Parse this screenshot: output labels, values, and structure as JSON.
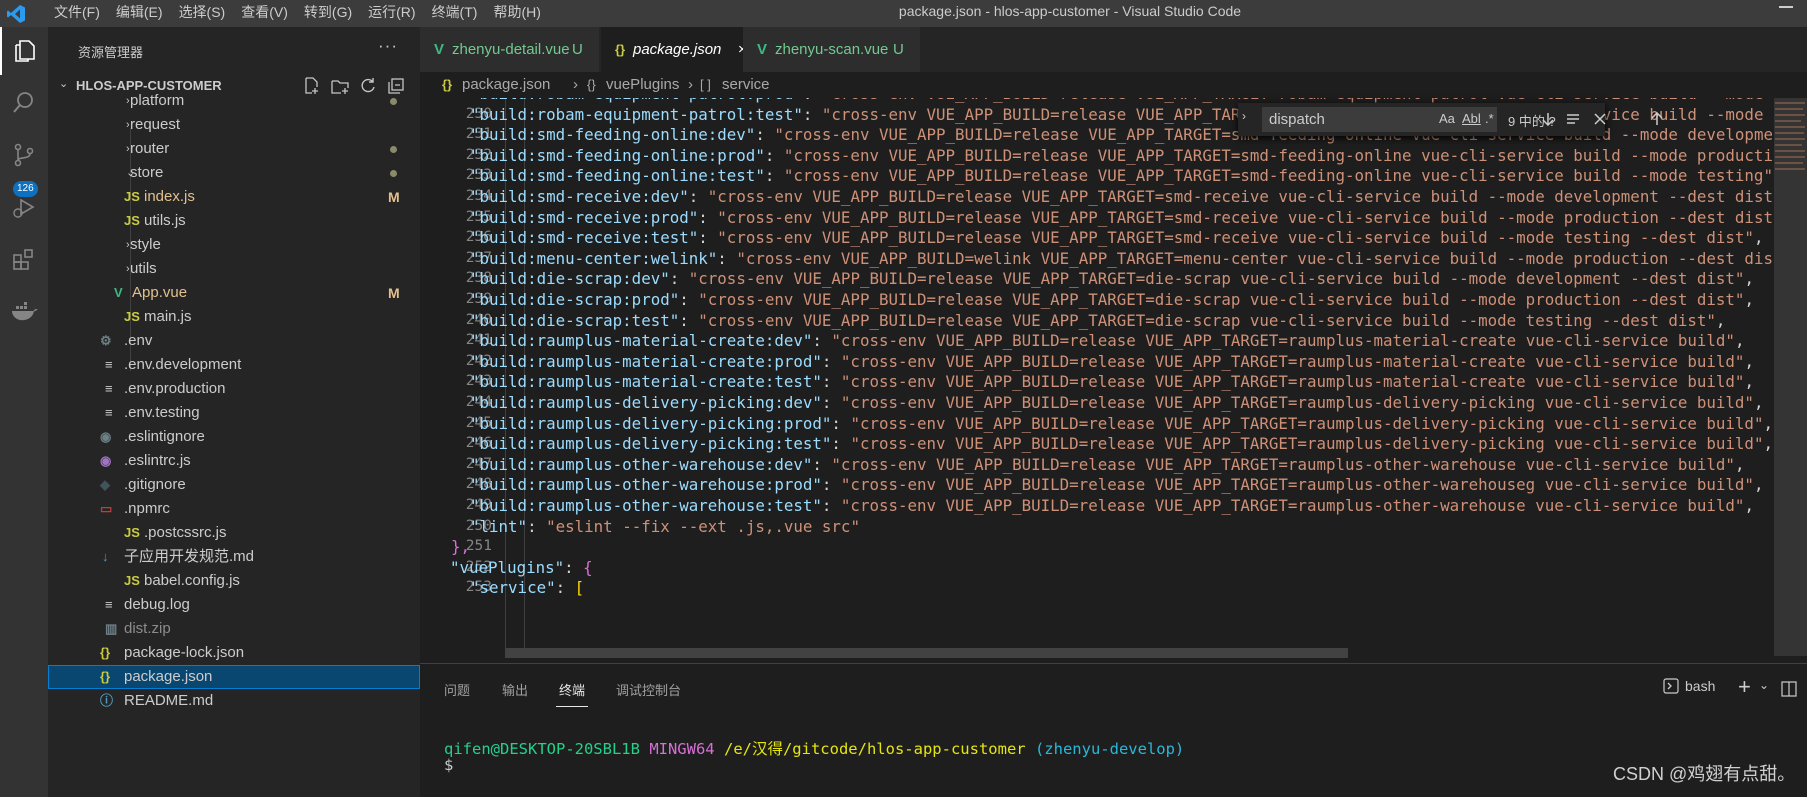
{
  "window": {
    "title": "package.json - hlos-app-customer - Visual Studio Code"
  },
  "menu": [
    "文件(F)",
    "编辑(E)",
    "选择(S)",
    "查看(V)",
    "转到(G)",
    "运行(R)",
    "终端(T)",
    "帮助(H)"
  ],
  "activity": {
    "scm_badge": "126"
  },
  "explorer": {
    "title": "资源管理器",
    "more": "···",
    "project": "HLOS-APP-CUSTOMER",
    "items": [
      {
        "name": "platform",
        "kind": "folder",
        "status": "dot"
      },
      {
        "name": "request",
        "kind": "folder",
        "status": ""
      },
      {
        "name": "router",
        "kind": "folder",
        "status": "dot"
      },
      {
        "name": "store",
        "kind": "folder-open",
        "status": "dot"
      },
      {
        "name": "index.js",
        "kind": "js",
        "status": "M"
      },
      {
        "name": "utils.js",
        "kind": "js",
        "status": ""
      },
      {
        "name": "style",
        "kind": "folder",
        "status": ""
      },
      {
        "name": "utils",
        "kind": "folder",
        "status": ""
      },
      {
        "name": "App.vue",
        "kind": "vue",
        "status": "M"
      },
      {
        "name": "main.js",
        "kind": "js",
        "status": ""
      },
      {
        "name": ".env",
        "kind": "gear",
        "status": ""
      },
      {
        "name": ".env.development",
        "kind": "lines",
        "status": ""
      },
      {
        "name": ".env.production",
        "kind": "lines",
        "status": ""
      },
      {
        "name": ".env.testing",
        "kind": "lines",
        "status": ""
      },
      {
        "name": ".eslintignore",
        "kind": "eslint-ignore",
        "status": ""
      },
      {
        "name": ".eslintrc.js",
        "kind": "eslint",
        "status": ""
      },
      {
        "name": ".gitignore",
        "kind": "git",
        "status": ""
      },
      {
        "name": ".npmrc",
        "kind": "npm",
        "status": ""
      },
      {
        "name": ".postcssrc.js",
        "kind": "js",
        "status": ""
      },
      {
        "name": "子应用开发规范.md",
        "kind": "md",
        "status": ""
      },
      {
        "name": "babel.config.js",
        "kind": "js",
        "status": ""
      },
      {
        "name": "debug.log",
        "kind": "lines",
        "status": ""
      },
      {
        "name": "dist.zip",
        "kind": "zip",
        "status": ""
      },
      {
        "name": "package-lock.json",
        "kind": "json",
        "status": ""
      },
      {
        "name": "package.json",
        "kind": "json",
        "status": "",
        "selected": true
      },
      {
        "name": "README.md",
        "kind": "info",
        "status": ""
      }
    ]
  },
  "tabs": [
    {
      "label": "zhenyu-detail.vue",
      "icon": "vue",
      "status": "U"
    },
    {
      "label": "package.json",
      "icon": "json",
      "status": "×"
    },
    {
      "label": "zhenyu-scan.vue",
      "icon": "vue",
      "status": "U"
    }
  ],
  "breadcrumb": {
    "file_icon": "{}",
    "file": "package.json",
    "sep1": "›",
    "node1_icon": "{}",
    "node1": "vuePlugins",
    "sep2": "›",
    "node2_icon": "[ ]",
    "node2": "service"
  },
  "find": {
    "query": "dispatch",
    "opt_case": "Aa",
    "opt_word": "Abl",
    "opt_regex": ".*",
    "count": "9 中的 ?"
  },
  "editor": {
    "lines": [
      {
        "n": "229",
        "k": "\"build:robam-equipment-patrol:prod\"",
        "v": "\"cross-env VUE_APP_BUILD=release VUE_APP_TARGET=robam-equipment-patrol vue-cli-service build --mode production\""
      },
      {
        "n": "230",
        "k": "\"build:robam-equipment-patrol:test\"",
        "v": "\"cross-env VUE_APP_BUILD=release VUE_APP_TARGET=robam-equipment-patrol vue-cli-service build --mode testing --dest dist/robam-equipment-patrol-file\""
      },
      {
        "n": "231",
        "k": "\"build:smd-feeding-online:dev\"",
        "v": "\"cross-env VUE_APP_BUILD=release VUE_APP_TARGET=smd-feeding-online vue-cli-service build --mode development\""
      },
      {
        "n": "232",
        "k": "\"build:smd-feeding-online:prod\"",
        "v": "\"cross-env VUE_APP_BUILD=release VUE_APP_TARGET=smd-feeding-online vue-cli-service build --mode production\""
      },
      {
        "n": "233",
        "k": "\"build:smd-feeding-online:test\"",
        "v": "\"cross-env VUE_APP_BUILD=release VUE_APP_TARGET=smd-feeding-online vue-cli-service build --mode testing\""
      },
      {
        "n": "234",
        "k": "\"build:smd-receive:dev\"",
        "v": "\"cross-env VUE_APP_BUILD=release VUE_APP_TARGET=smd-receive vue-cli-service build --mode development --dest dist\""
      },
      {
        "n": "235",
        "k": "\"build:smd-receive:prod\"",
        "v": "\"cross-env VUE_APP_BUILD=release VUE_APP_TARGET=smd-receive vue-cli-service build --mode production --dest dist\""
      },
      {
        "n": "236",
        "k": "\"build:smd-receive:test\"",
        "v": "\"cross-env VUE_APP_BUILD=release VUE_APP_TARGET=smd-receive vue-cli-service build --mode testing --dest dist\""
      },
      {
        "n": "237",
        "k": "\"build:menu-center:welink\"",
        "v": "\"cross-env VUE_APP_BUILD=welink VUE_APP_TARGET=menu-center vue-cli-service build --mode production --dest dist\""
      },
      {
        "n": "238",
        "k": "\"build:die-scrap:dev\"",
        "v": "\"cross-env VUE_APP_BUILD=release VUE_APP_TARGET=die-scrap vue-cli-service build --mode development --dest dist\""
      },
      {
        "n": "239",
        "k": "\"build:die-scrap:prod\"",
        "v": "\"cross-env VUE_APP_BUILD=release VUE_APP_TARGET=die-scrap vue-cli-service build --mode production --dest dist\""
      },
      {
        "n": "240",
        "k": "\"build:die-scrap:test\"",
        "v": "\"cross-env VUE_APP_BUILD=release VUE_APP_TARGET=die-scrap vue-cli-service build --mode testing --dest dist\""
      },
      {
        "n": "241",
        "k": "\"build:raumplus-material-create:dev\"",
        "v": "\"cross-env VUE_APP_BUILD=release VUE_APP_TARGET=raumplus-material-create vue-cli-service build\""
      },
      {
        "n": "242",
        "k": "\"build:raumplus-material-create:prod\"",
        "v": "\"cross-env VUE_APP_BUILD=release VUE_APP_TARGET=raumplus-material-create vue-cli-service build\""
      },
      {
        "n": "243",
        "k": "\"build:raumplus-material-create:test\"",
        "v": "\"cross-env VUE_APP_BUILD=release VUE_APP_TARGET=raumplus-material-create vue-cli-service build\""
      },
      {
        "n": "244",
        "k": "\"build:raumplus-delivery-picking:dev\"",
        "v": "\"cross-env VUE_APP_BUILD=release VUE_APP_TARGET=raumplus-delivery-picking vue-cli-service build\""
      },
      {
        "n": "245",
        "k": "\"build:raumplus-delivery-picking:prod\"",
        "v": "\"cross-env VUE_APP_BUILD=release VUE_APP_TARGET=raumplus-delivery-picking vue-cli-service build\""
      },
      {
        "n": "246",
        "k": "\"build:raumplus-delivery-picking:test\"",
        "v": "\"cross-env VUE_APP_BUILD=release VUE_APP_TARGET=raumplus-delivery-picking vue-cli-service build\""
      },
      {
        "n": "247",
        "k": "\"build:raumplus-other-warehouse:dev\"",
        "v": "\"cross-env VUE_APP_BUILD=release VUE_APP_TARGET=raumplus-other-warehouse vue-cli-service build\""
      },
      {
        "n": "248",
        "k": "\"build:raumplus-other-warehouse:prod\"",
        "v": "\"cross-env VUE_APP_BUILD=release VUE_APP_TARGET=raumplus-other-warehouseg vue-cli-service build\""
      },
      {
        "n": "249",
        "k": "\"build:raumplus-other-warehouse:test\"",
        "v": "\"cross-env VUE_APP_BUILD=release VUE_APP_TARGET=raumplus-other-warehouse vue-cli-service build\""
      },
      {
        "n": "250",
        "k": "\"lint\"",
        "v": "\"eslint --fix --ext .js,.vue src\""
      },
      {
        "n": "251",
        "raw": "},"
      },
      {
        "n": "252",
        "k": "\"vuePlugins\"",
        "v": "{",
        "open": true
      },
      {
        "n": "253",
        "k": "\"service\"",
        "v": "["
      }
    ]
  },
  "panel": {
    "tabs": [
      "问题",
      "输出",
      "终端",
      "调试控制台"
    ],
    "active": "终端",
    "shell": "bash",
    "prompt_user": "qifen@DESKTOP-20SBL1B",
    "prompt_env": "MINGW64",
    "prompt_path": "/e/汉得/gitcode/hlos-app-customer",
    "prompt_branch": "(zhenyu-develop)",
    "cursor": "$"
  },
  "watermark": "CSDN @鸡翅有点甜。",
  "colors": {
    "accent": "#007acc",
    "modified": "#e2c08d",
    "untracked": "#73c991",
    "vue": "#41b883",
    "json": "#cbcb41",
    "js": "#cbcb41"
  }
}
